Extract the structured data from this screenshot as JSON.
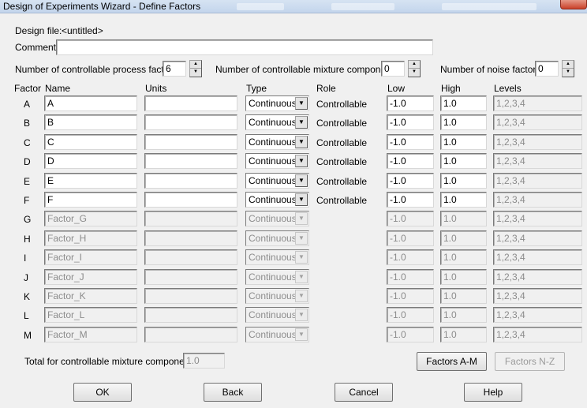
{
  "window": {
    "title": "Design of Experiments Wizard - Define Factors"
  },
  "design_file": {
    "label": "Design file:",
    "value": "<untitled>"
  },
  "comment": {
    "label": "Comment:",
    "value": ""
  },
  "counts": {
    "process_label": "Number of controllable process factors:",
    "process_value": "6",
    "mixture_label": "Number of controllable mixture components:",
    "mixture_value": "0",
    "noise_label": "Number of noise factors:",
    "noise_value": "0"
  },
  "headers": {
    "factor": "Factor",
    "name": "Name",
    "units": "Units",
    "type": "Type",
    "role": "Role",
    "low": "Low",
    "high": "High",
    "levels": "Levels"
  },
  "factors": [
    {
      "letter": "A",
      "name": "A",
      "units": "",
      "type": "Continuous",
      "role": "Controllable",
      "low": "-1.0",
      "high": "1.0",
      "levels": "1,2,3,4",
      "enabled": true
    },
    {
      "letter": "B",
      "name": "B",
      "units": "",
      "type": "Continuous",
      "role": "Controllable",
      "low": "-1.0",
      "high": "1.0",
      "levels": "1,2,3,4",
      "enabled": true
    },
    {
      "letter": "C",
      "name": "C",
      "units": "",
      "type": "Continuous",
      "role": "Controllable",
      "low": "-1.0",
      "high": "1.0",
      "levels": "1,2,3,4",
      "enabled": true
    },
    {
      "letter": "D",
      "name": "D",
      "units": "",
      "type": "Continuous",
      "role": "Controllable",
      "low": "-1.0",
      "high": "1.0",
      "levels": "1,2,3,4",
      "enabled": true
    },
    {
      "letter": "E",
      "name": "E",
      "units": "",
      "type": "Continuous",
      "role": "Controllable",
      "low": "-1.0",
      "high": "1.0",
      "levels": "1,2,3,4",
      "enabled": true
    },
    {
      "letter": "F",
      "name": "F",
      "units": "",
      "type": "Continuous",
      "role": "Controllable",
      "low": "-1.0",
      "high": "1.0",
      "levels": "1,2,3,4",
      "enabled": true
    },
    {
      "letter": "G",
      "name": "Factor_G",
      "units": "",
      "type": "Continuous",
      "role": "",
      "low": "-1.0",
      "high": "1.0",
      "levels": "1,2,3,4",
      "enabled": false
    },
    {
      "letter": "H",
      "name": "Factor_H",
      "units": "",
      "type": "Continuous",
      "role": "",
      "low": "-1.0",
      "high": "1.0",
      "levels": "1,2,3,4",
      "enabled": false
    },
    {
      "letter": "I",
      "name": "Factor_I",
      "units": "",
      "type": "Continuous",
      "role": "",
      "low": "-1.0",
      "high": "1.0",
      "levels": "1,2,3,4",
      "enabled": false
    },
    {
      "letter": "J",
      "name": "Factor_J",
      "units": "",
      "type": "Continuous",
      "role": "",
      "low": "-1.0",
      "high": "1.0",
      "levels": "1,2,3,4",
      "enabled": false
    },
    {
      "letter": "K",
      "name": "Factor_K",
      "units": "",
      "type": "Continuous",
      "role": "",
      "low": "-1.0",
      "high": "1.0",
      "levels": "1,2,3,4",
      "enabled": false
    },
    {
      "letter": "L",
      "name": "Factor_L",
      "units": "",
      "type": "Continuous",
      "role": "",
      "low": "-1.0",
      "high": "1.0",
      "levels": "1,2,3,4",
      "enabled": false
    },
    {
      "letter": "M",
      "name": "Factor_M",
      "units": "",
      "type": "Continuous",
      "role": "",
      "low": "-1.0",
      "high": "1.0",
      "levels": "1,2,3,4",
      "enabled": false
    }
  ],
  "total": {
    "label": "Total for controllable mixture components:",
    "value": "1.0"
  },
  "buttons": {
    "factors_am": "Factors A-M",
    "factors_nz": "Factors N-Z",
    "ok": "OK",
    "back": "Back",
    "cancel": "Cancel",
    "help": "Help"
  },
  "icons": {
    "dropdown": "▼",
    "spin_up": "▲",
    "spin_down": "▼"
  }
}
